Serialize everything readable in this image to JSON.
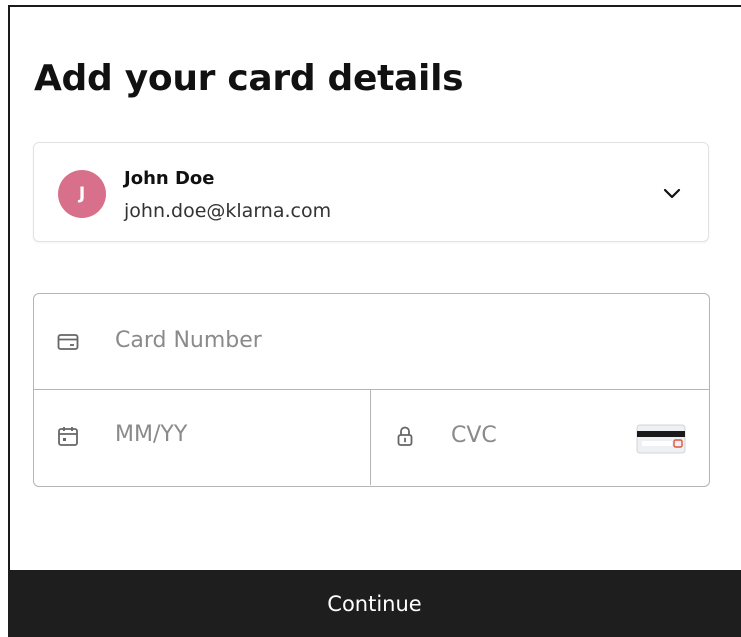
{
  "page": {
    "title": "Add your card details"
  },
  "account": {
    "avatar_initial": "J",
    "name": "John Doe",
    "email": "john.doe@klarna.com",
    "avatar_color": "#d86f8b",
    "chevron_icon": "chevron-down-icon"
  },
  "card_form": {
    "card_number": {
      "placeholder": "Card Number",
      "value": "",
      "icon": "credit-card-icon"
    },
    "expiry": {
      "placeholder": "MM/YY",
      "value": "",
      "icon": "calendar-icon"
    },
    "cvc": {
      "placeholder": "CVC",
      "value": "",
      "icon": "lock-icon",
      "hint_icon": "card-back-cvc-icon"
    }
  },
  "actions": {
    "continue_label": "Continue",
    "continue_bg": "#1e1e1e"
  }
}
